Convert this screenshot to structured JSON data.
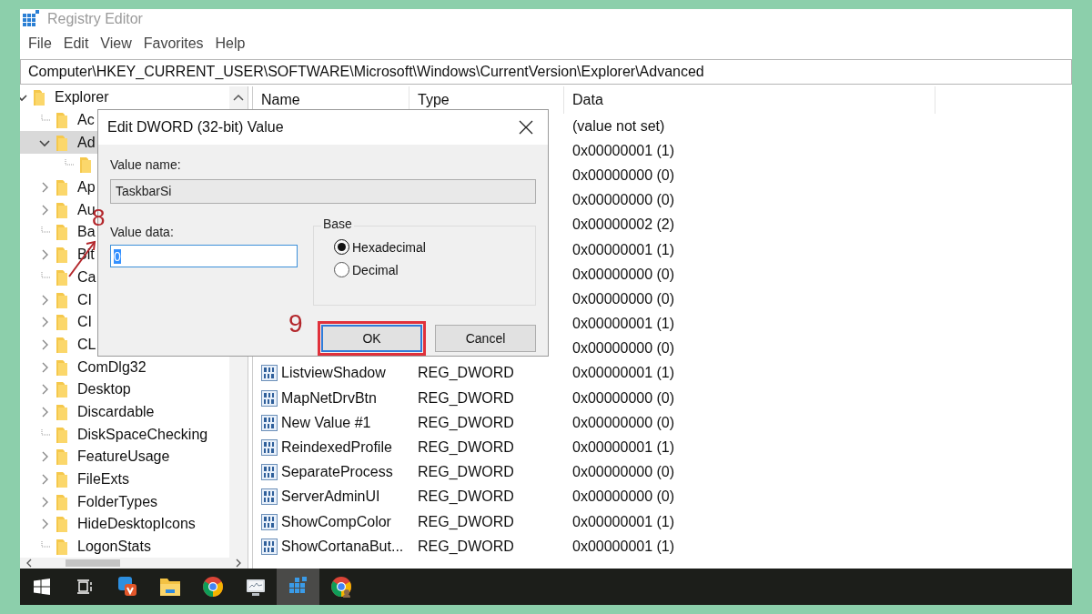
{
  "window": {
    "title": "Registry Editor"
  },
  "menu": [
    "File",
    "Edit",
    "View",
    "Favorites",
    "Help"
  ],
  "address": "Computer\\HKEY_CURRENT_USER\\SOFTWARE\\Microsoft\\Windows\\CurrentVersion\\Explorer\\Advanced",
  "tree": [
    {
      "name": "Explorer",
      "expandable": true,
      "expanded": true,
      "selected": false,
      "children": [
        {
          "name": "Ac",
          "expandable": false,
          "selected": false
        },
        {
          "name": "Ad",
          "expandable": true,
          "expanded": true,
          "selected": true,
          "children": [
            {
              "expandable": false,
              "selected": false
            }
          ]
        },
        {
          "name": "Ap",
          "expandable": true,
          "expanded": false,
          "selected": false
        },
        {
          "name": "Au",
          "expandable": true,
          "expanded": false,
          "selected": false
        },
        {
          "name": "Ba",
          "expandable": false,
          "selected": false
        },
        {
          "name": "Bit",
          "expandable": true,
          "expanded": false,
          "selected": false
        },
        {
          "name": "Ca",
          "expandable": false,
          "selected": false
        },
        {
          "name": "CI",
          "expandable": true,
          "expanded": false,
          "selected": false
        },
        {
          "name": "CI",
          "expandable": true,
          "expanded": false,
          "selected": false
        },
        {
          "name": "CL",
          "expandable": true,
          "expanded": false,
          "selected": false
        },
        {
          "name": "ComDlg32",
          "expandable": true,
          "expanded": false,
          "selected": false
        },
        {
          "name": "Desktop",
          "expandable": true,
          "expanded": false,
          "selected": false
        },
        {
          "name": "Discardable",
          "expandable": true,
          "expanded": false,
          "selected": false
        },
        {
          "name": "DiskSpaceChecking",
          "expandable": false,
          "selected": false
        },
        {
          "name": "FeatureUsage",
          "expandable": true,
          "expanded": false,
          "selected": false
        },
        {
          "name": "FileExts",
          "expandable": true,
          "expanded": false,
          "selected": false
        },
        {
          "name": "FolderTypes",
          "expandable": true,
          "expanded": false,
          "selected": false
        },
        {
          "name": "HideDesktopIcons",
          "expandable": true,
          "expanded": false,
          "selected": false
        },
        {
          "name": "LogonStats",
          "expandable": false,
          "selected": false
        }
      ]
    }
  ],
  "list": {
    "columns": [
      "Name",
      "Type",
      "Data"
    ],
    "rows": [
      {
        "data": "(value not set)"
      },
      {
        "data": "0x00000001 (1)"
      },
      {
        "data": "0x00000000 (0)"
      },
      {
        "data": "0x00000000 (0)"
      },
      {
        "data": "0x00000002 (2)"
      },
      {
        "data": "0x00000001 (1)"
      },
      {
        "data": "0x00000000 (0)"
      },
      {
        "data": "0x00000000 (0)"
      },
      {
        "data": "0x00000001 (1)"
      },
      {
        "data": "0x00000000 (0)"
      },
      {
        "name": "ListviewShadow",
        "type": "REG_DWORD",
        "data": "0x00000001 (1)"
      },
      {
        "name": "MapNetDrvBtn",
        "type": "REG_DWORD",
        "data": "0x00000000 (0)"
      },
      {
        "name": "New Value #1",
        "type": "REG_DWORD",
        "data": "0x00000000 (0)"
      },
      {
        "name": "ReindexedProfile",
        "type": "REG_DWORD",
        "data": "0x00000001 (1)"
      },
      {
        "name": "SeparateProcess",
        "type": "REG_DWORD",
        "data": "0x00000000 (0)"
      },
      {
        "name": "ServerAdminUI",
        "type": "REG_DWORD",
        "data": "0x00000000 (0)"
      },
      {
        "name": "ShowCompColor",
        "type": "REG_DWORD",
        "data": "0x00000001 (1)"
      },
      {
        "name": "ShowCortanaBut...",
        "type": "REG_DWORD",
        "data": "0x00000001 (1)"
      }
    ]
  },
  "dialog": {
    "title": "Edit DWORD (32-bit) Value",
    "value_name_label": "Value name:",
    "value_name": "TaskbarSi",
    "value_data_label": "Value data:",
    "value_data": "0",
    "base_label": "Base",
    "bases": [
      {
        "label": "Hexadecimal",
        "selected": true
      },
      {
        "label": "Decimal",
        "selected": false
      }
    ],
    "buttons": [
      {
        "label": "OK",
        "highlighted": true
      },
      {
        "label": "Cancel",
        "highlighted": false
      }
    ]
  },
  "annotations": [
    {
      "kind": "arrow",
      "text": "8"
    },
    {
      "kind": "number",
      "text": "9"
    }
  ],
  "taskbar": {
    "items": [
      {
        "kind": "start",
        "selected": false
      },
      {
        "kind": "taskview",
        "selected": false
      },
      {
        "kind": "app",
        "selected": false
      },
      {
        "kind": "folder",
        "selected": false
      },
      {
        "kind": "browser",
        "selected": false
      },
      {
        "kind": "monitor",
        "selected": false
      },
      {
        "kind": "registry",
        "selected": true
      },
      {
        "kind": "browser-profile",
        "selected": false
      }
    ]
  }
}
